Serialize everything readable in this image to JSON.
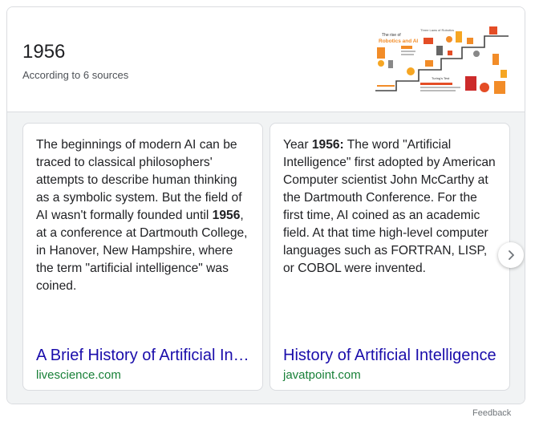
{
  "answer": {
    "title": "1956",
    "subtitle": "According to 6 sources",
    "thumbnail_icon": "infographic-timeline-thumbnail",
    "thumbnail_text": {
      "heading_line1": "The rise of",
      "heading_line2": "Robotics and AI",
      "subheading": "Three Laws of Robotics",
      "footer_label": "Turing's Test"
    }
  },
  "cards": [
    {
      "snippet_parts": [
        {
          "text": "The beginnings of modern AI can be traced to classical philosophers' attempts to describe human thinking as a symbolic system. But the field of AI wasn't formally founded until ",
          "bold": false
        },
        {
          "text": "1956",
          "bold": true
        },
        {
          "text": ", at a conference at Dartmouth College, in Hanover, New Hampshire, where the term \"artificial intelligence\" was coined.",
          "bold": false
        }
      ],
      "title": "A Brief History of Artificial Intelligence",
      "source": "livescience.com"
    },
    {
      "snippet_parts": [
        {
          "text": "Year ",
          "bold": false
        },
        {
          "text": "1956:",
          "bold": true
        },
        {
          "text": " The word \"Artificial Intelligence\" first adopted by American Computer scientist John McCarthy at the Dartmouth Conference. For the first time, AI coined as an academic field. At that time high-level computer languages such as FORTRAN, LISP, or COBOL were invented.",
          "bold": false
        }
      ],
      "title": "History of Artificial Intelligence",
      "source": "javatpoint.com"
    }
  ],
  "next_icon": "chevron-right-icon",
  "feedback_label": "Feedback",
  "colors": {
    "link": "#1a0dab",
    "source": "#188038",
    "carousel_bg": "#f1f3f4",
    "border": "#dadce0"
  }
}
